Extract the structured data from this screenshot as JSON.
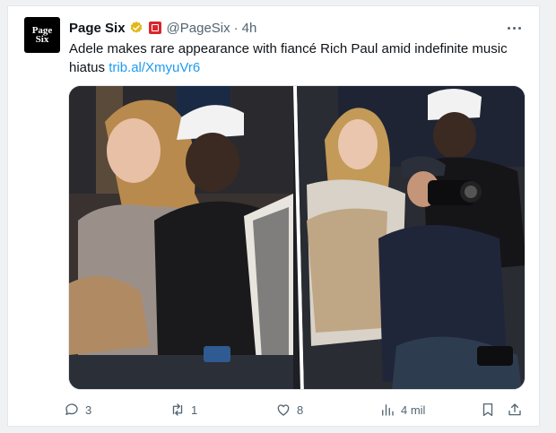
{
  "tweet": {
    "avatar_line1": "Page",
    "avatar_line2": "Six",
    "display_name": "Page Six",
    "handle": "@PageSix",
    "separator": "·",
    "time": "4h",
    "text": "Adele makes rare appearance with fiancé Rich Paul amid indefinite music hiatus",
    "link": "trib.al/XmyuVr6"
  },
  "actions": {
    "replies": "3",
    "retweets": "1",
    "likes": "8",
    "views": "4 mil"
  },
  "colors": {
    "accent": "#1d9bf0",
    "verified": "#e2b719",
    "affiliate_badge": "#d9262c",
    "muted_text": "#536471"
  },
  "icons": [
    "verified-badge-icon",
    "affiliate-badge-icon",
    "more-options-icon",
    "reply-icon",
    "retweet-icon",
    "like-icon",
    "views-icon",
    "bookmark-icon",
    "share-icon"
  ]
}
